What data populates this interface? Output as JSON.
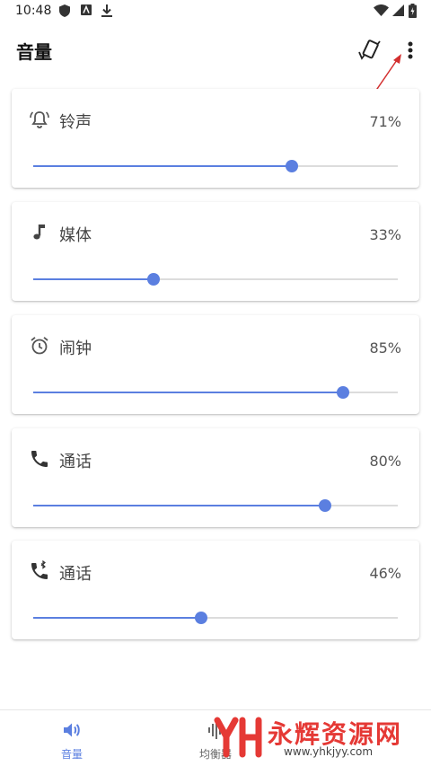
{
  "status_bar": {
    "time": "10:48"
  },
  "app_bar": {
    "title": "音量"
  },
  "cards": [
    {
      "label": "铃声",
      "percent": "71%",
      "value": 0.71,
      "icon": "bell-icon"
    },
    {
      "label": "媒体",
      "percent": "33%",
      "value": 0.33,
      "icon": "music-note-icon"
    },
    {
      "label": "闹钟",
      "percent": "85%",
      "value": 0.85,
      "icon": "alarm-clock-icon"
    },
    {
      "label": "通话",
      "percent": "80%",
      "value": 0.8,
      "icon": "phone-icon"
    },
    {
      "label": "通话",
      "percent": "46%",
      "value": 0.46,
      "icon": "bluetooth-phone-icon"
    }
  ],
  "bottom_nav": [
    {
      "label": "音量",
      "icon": "volume-icon",
      "active": true
    },
    {
      "label": "均衡器",
      "icon": "equalizer-icon",
      "active": false
    }
  ],
  "watermark": {
    "text": "永辉资源网",
    "url": "www.yhkjyy.com"
  },
  "colors": {
    "accent": "#5b7fe0",
    "track": "#dcdcdc",
    "watermark": "#e53935"
  }
}
